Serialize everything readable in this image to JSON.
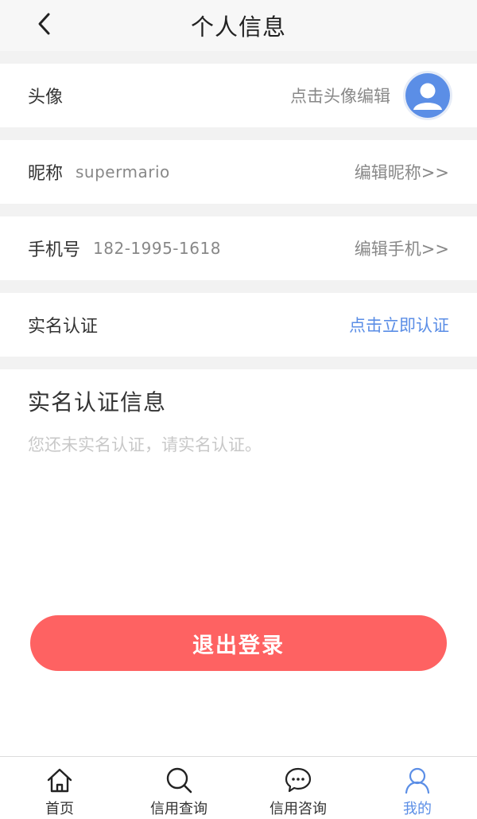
{
  "header": {
    "title": "个人信息"
  },
  "avatar_row": {
    "label": "头像",
    "action": "点击头像编辑"
  },
  "nickname_row": {
    "label": "昵称",
    "value": "supermario",
    "action": "编辑昵称>>"
  },
  "phone_row": {
    "label": "手机号",
    "value": "182-1995-1618",
    "action": "编辑手机>>"
  },
  "realname_row": {
    "label": "实名认证",
    "action": "点击立即认证"
  },
  "realname_info": {
    "title": "实名认证信息",
    "empty_text": "您还未实名认证，请实名认证。"
  },
  "logout": {
    "label": "退出登录"
  },
  "tabbar": {
    "items": [
      {
        "label": "首页",
        "icon": "home-icon"
      },
      {
        "label": "信用查询",
        "icon": "search-icon"
      },
      {
        "label": "信用咨询",
        "icon": "chat-icon"
      },
      {
        "label": "我的",
        "icon": "user-icon",
        "active": true
      }
    ]
  },
  "colors": {
    "accent": "#5b8ee6",
    "logout": "#fe6262",
    "avatar": "#5b8ee6"
  }
}
